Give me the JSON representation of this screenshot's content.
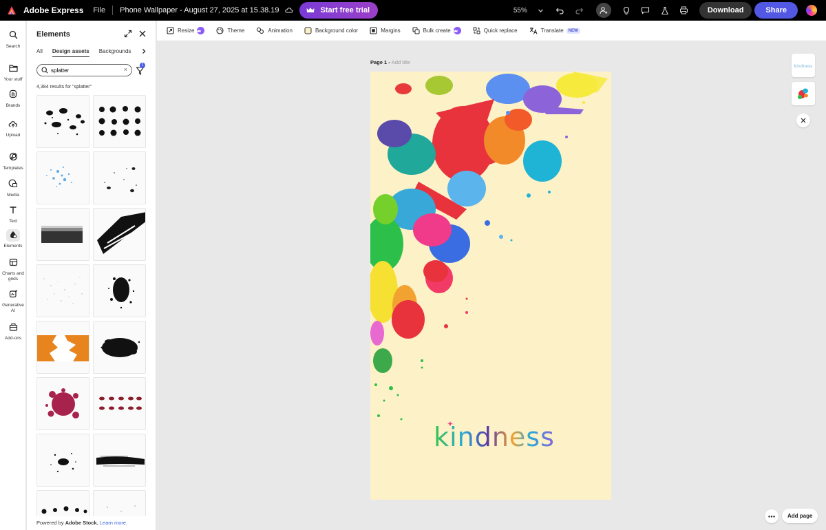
{
  "topbar": {
    "app_name": "Adobe Express",
    "file_menu": "File",
    "doc_title": "Phone Wallpaper - August 27, 2025 at 15.38.19",
    "trial_button": "Start free trial",
    "zoom": "55%",
    "download_button": "Download",
    "share_button": "Share"
  },
  "rail": {
    "items": [
      {
        "label": "Search",
        "icon": "search-icon"
      },
      {
        "label": "Your stuff",
        "icon": "folder-icon"
      },
      {
        "label": "Brands",
        "icon": "brand-icon"
      },
      {
        "label": "Upload",
        "icon": "upload-icon"
      },
      {
        "label": "Templates",
        "icon": "templates-icon"
      },
      {
        "label": "Media",
        "icon": "media-icon"
      },
      {
        "label": "Text",
        "icon": "text-icon"
      },
      {
        "label": "Elements",
        "icon": "elements-icon"
      },
      {
        "label": "Charts and grids",
        "icon": "charts-icon"
      },
      {
        "label": "Generative AI",
        "icon": "generative-ai-icon"
      },
      {
        "label": "Add-ons",
        "icon": "addons-icon"
      }
    ]
  },
  "panel": {
    "title": "Elements",
    "tabs": [
      "All",
      "Design assets",
      "Backgrounds"
    ],
    "active_tab": "Design assets",
    "search_value": "splatter",
    "filter_count": "1",
    "results_text": "4,384 results for \"splatter\"",
    "footer_prefix": "Powered by",
    "footer_brand": "Adobe Stock.",
    "footer_link": "Learn more."
  },
  "canvas_toolbar": {
    "items": [
      {
        "label": "Resize",
        "icon": "resize-icon",
        "premium": true
      },
      {
        "label": "Theme",
        "icon": "theme-icon"
      },
      {
        "label": "Animation",
        "icon": "animation-icon"
      },
      {
        "label": "Background color",
        "icon": "background-color-icon"
      },
      {
        "label": "Margins",
        "icon": "margins-icon"
      },
      {
        "label": "Bulk create",
        "icon": "bulk-create-icon",
        "premium": true
      },
      {
        "label": "Quick replace",
        "icon": "quick-replace-icon"
      },
      {
        "label": "Translate",
        "icon": "translate-icon",
        "badge": "NEW"
      }
    ]
  },
  "canvas": {
    "page_label": "Page 1 -",
    "add_title": "Add title",
    "page_background": "#fdf1c8",
    "headline_text": "kindness",
    "add_page_button": "Add page"
  },
  "colors": {
    "accent": "#5258e4",
    "trial_gradient_start": "#7a3bd6",
    "trial_gradient_end": "#9b3fc8",
    "badge": "#4b5ce6"
  }
}
